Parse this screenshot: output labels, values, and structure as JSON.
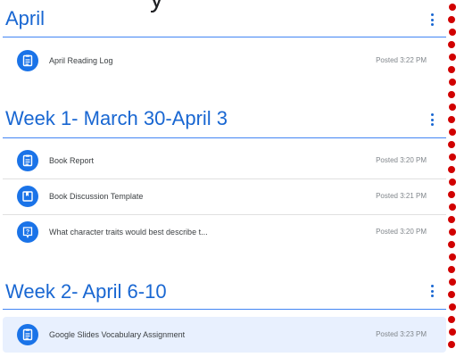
{
  "header_cutoff": "y",
  "topics": [
    {
      "title": "April",
      "items": [
        {
          "title": "April Reading Log",
          "posted": "Posted 3:22 PM",
          "icon": "assignment-icon"
        }
      ]
    },
    {
      "title": "Week 1- March 30-April 3",
      "items": [
        {
          "title": "Book Report",
          "posted": "Posted 3:20 PM",
          "icon": "assignment-icon"
        },
        {
          "title": "Book Discussion Template",
          "posted": "Posted 3:21 PM",
          "icon": "material-icon"
        },
        {
          "title": "What character traits would best describe t...",
          "posted": "Posted 3:20 PM",
          "icon": "question-icon"
        }
      ]
    },
    {
      "title": "Week 2- April 6-10",
      "items": [
        {
          "title": "Google Slides Vocabulary Assignment",
          "posted": "Posted 3:23 PM",
          "icon": "assignment-icon",
          "highlighted": true
        }
      ]
    }
  ],
  "colors": {
    "accent": "#1967d2",
    "icon_bg": "#1a73e8",
    "row_highlight": "#e8f0fe",
    "dot_border": "#d10000"
  }
}
